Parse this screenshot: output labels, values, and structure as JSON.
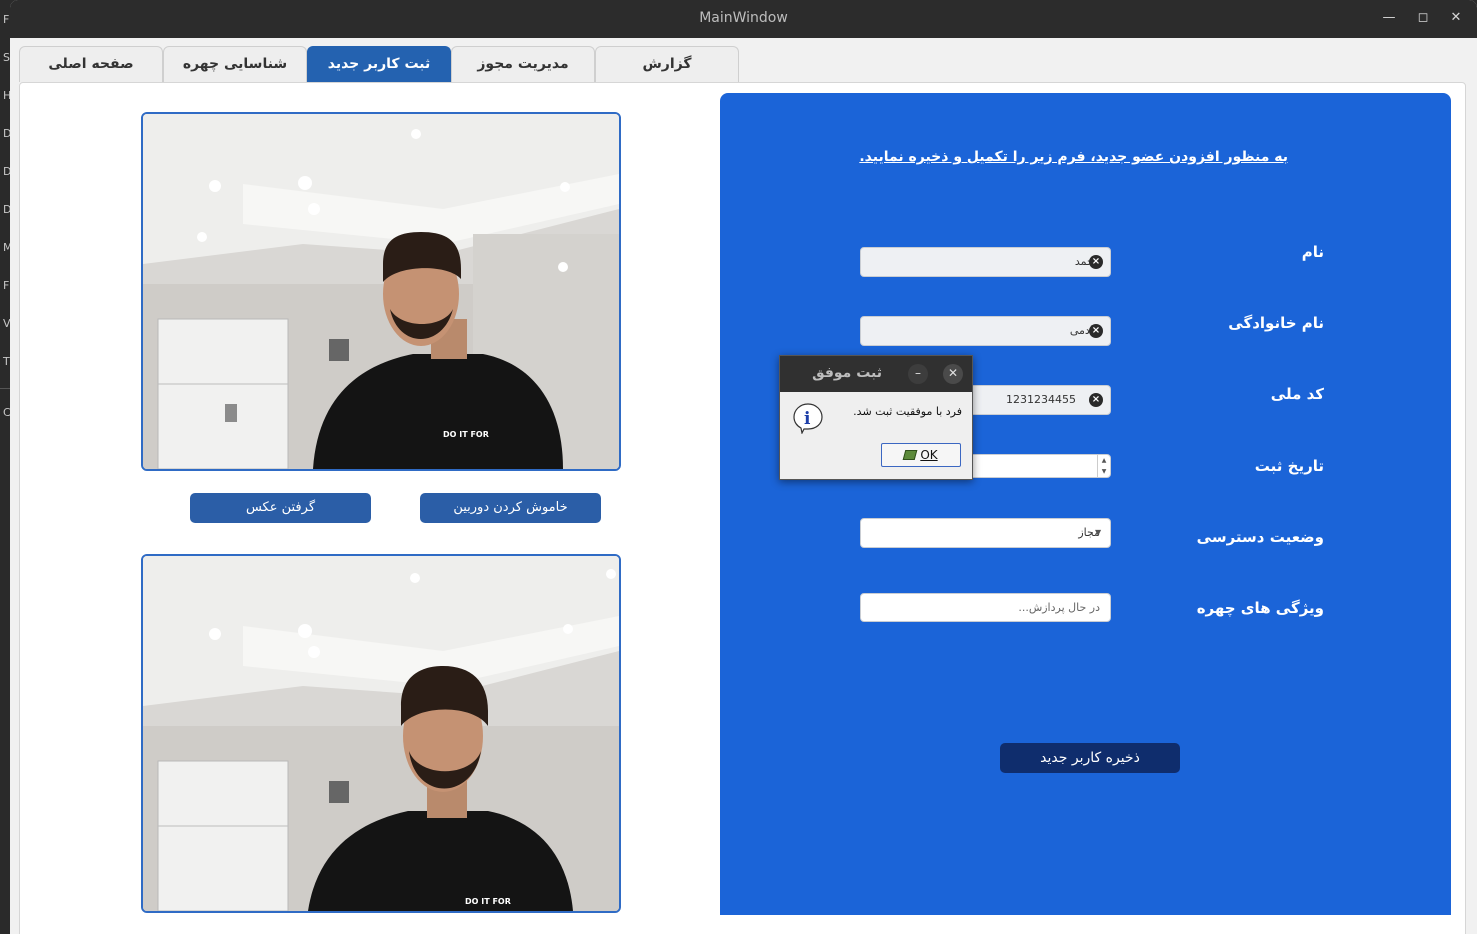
{
  "window": {
    "title": "MainWindow",
    "minimize_icon": "minimize-icon",
    "maximize_icon": "maximize-icon",
    "close_icon": "close-icon"
  },
  "background_window": {
    "letters": [
      "F",
      "S",
      "H",
      "D",
      "D",
      "D",
      "M",
      "F",
      "V",
      "T",
      "C"
    ]
  },
  "tabs": [
    {
      "label": "صفحه اصلی",
      "active": false
    },
    {
      "label": "شناسایی چهره",
      "active": false
    },
    {
      "label": "ثبت کاربر جدید",
      "active": true
    },
    {
      "label": "مدیریت مجوز",
      "active": false
    },
    {
      "label": "گزارش",
      "active": false
    }
  ],
  "camera": {
    "stop_label": "خاموش کردن دوربین",
    "capture_label": "گرفتن عکس",
    "shirt_text": "DO IT FOR"
  },
  "form": {
    "intro": "به منظور افزودن عضو جدید، فرم زیر را تکمیل و ذخیره نمایید.",
    "labels": {
      "first_name": "نام",
      "last_name": "نام خانوادگی",
      "national_code": "کد ملی",
      "register_date": "تاریخ ثبت",
      "access_status": "وضعیت دسترسی",
      "face_features": "ویژگی های چهره"
    },
    "values": {
      "first_name": "محمد",
      "last_name": "خادمی",
      "national_code": "1231234455",
      "register_date": "",
      "access_status": "مجاز",
      "face_features": "در حال پردازش..."
    },
    "save_label": "ذخیره کاربر جدید"
  },
  "dialog": {
    "title": "ثبت موفق",
    "message": "فرد با موفقیت ثبت شد.",
    "ok_label": "OK"
  },
  "colors": {
    "panel": "#1b64d8",
    "active_tab": "#2462b0",
    "save_button": "#0f2d6d",
    "camera_border": "#2f6bc5"
  }
}
